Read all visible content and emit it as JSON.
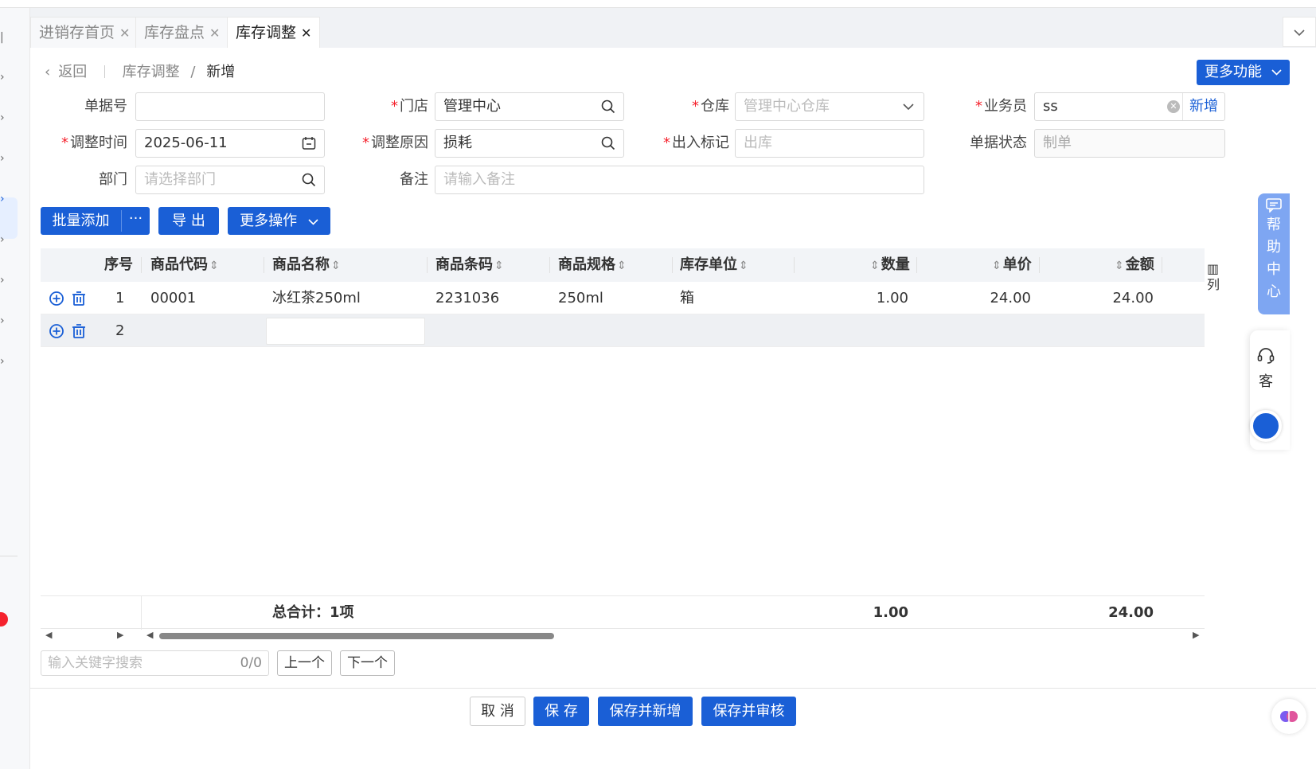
{
  "tabs": [
    {
      "label": "进销存首页"
    },
    {
      "label": "库存盘点"
    },
    {
      "label": "库存调整"
    }
  ],
  "breadcrumb": {
    "back": "返回",
    "parent": "库存调整",
    "sep": "/",
    "current": "新增"
  },
  "more_functions": "更多功能",
  "form": {
    "doc_no": {
      "label": "单据号",
      "value": ""
    },
    "store": {
      "label": "门店",
      "value": "管理中心"
    },
    "warehouse": {
      "label": "仓库",
      "placeholder": "管理中心仓库"
    },
    "salesperson": {
      "label": "业务员",
      "value": "ss",
      "add_label": "新增"
    },
    "adjust_time": {
      "label": "调整时间",
      "value": "2025-06-11"
    },
    "adjust_reason": {
      "label": "调整原因",
      "value": "损耗"
    },
    "io_flag": {
      "label": "出入标记",
      "value": "出库"
    },
    "doc_status": {
      "label": "单据状态",
      "value": "制单"
    },
    "department": {
      "label": "部门",
      "placeholder": "请选择部门"
    },
    "remark": {
      "label": "备注",
      "placeholder": "请输入备注"
    }
  },
  "toolbar": {
    "batch_add": "批量添加",
    "more_dots": "···",
    "export": "导 出",
    "more_ops": "更多操作"
  },
  "grid": {
    "headers": {
      "seq": "序号",
      "code": "商品代码",
      "name": "商品名称",
      "barcode": "商品条码",
      "spec": "商品规格",
      "unit": "库存单位",
      "qty": "数量",
      "price": "单价",
      "amount": "金额"
    },
    "rows": [
      {
        "seq": "1",
        "code": "00001",
        "name": "冰红茶250ml",
        "barcode": "2231036",
        "spec": "250ml",
        "unit": "箱",
        "qty": "1.00",
        "price": "24.00",
        "amount": "24.00"
      },
      {
        "seq": "2",
        "code": "",
        "name": "",
        "barcode": "",
        "spec": "",
        "unit": "",
        "qty": "",
        "price": "",
        "amount": ""
      }
    ],
    "column_settings": "列",
    "footer": {
      "total_label": "总合计：1项",
      "total_qty": "1.00",
      "total_amount": "24.00"
    }
  },
  "search": {
    "placeholder": "输入关键字搜索",
    "count": "0/0",
    "prev": "上一个",
    "next": "下一个"
  },
  "actions": {
    "cancel": "取 消",
    "save": "保 存",
    "save_new": "保存并新增",
    "save_audit": "保存并审核"
  },
  "help_center": {
    "chars": [
      "帮",
      "助",
      "中",
      "心"
    ]
  },
  "customer_service": "客",
  "colors": {
    "primary": "#1a5fd6",
    "required": "#f5222d",
    "help_bg": "#7ea6f2"
  }
}
